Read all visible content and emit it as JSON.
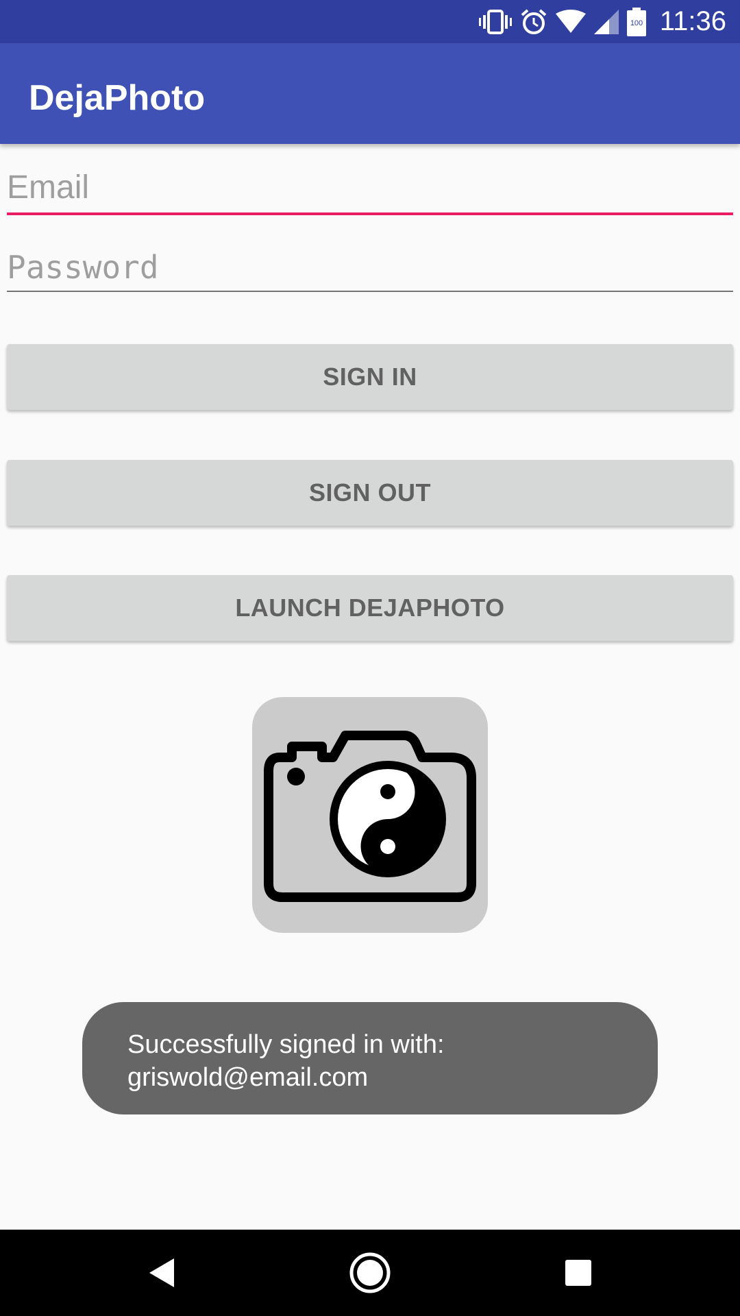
{
  "status_bar": {
    "time": "11:36",
    "battery_level": "100",
    "icons": [
      "vibrate-icon",
      "alarm-icon",
      "wifi-icon",
      "cell-signal-icon",
      "battery-icon"
    ]
  },
  "app_bar": {
    "title": "DejaPhoto"
  },
  "login": {
    "email_placeholder": "Email",
    "email_value": "",
    "password_placeholder": "Password",
    "password_value": ""
  },
  "buttons": {
    "sign_in": "SIGN IN",
    "sign_out": "SIGN OUT",
    "launch": "LAUNCH DEJAPHOTO"
  },
  "logo": {
    "icon": "camera-yin-yang-icon"
  },
  "toast": {
    "message": "Successfully signed in with:\ngriswold@email.com"
  },
  "nav_bar": {
    "icons": [
      "back-icon",
      "home-icon",
      "recents-icon"
    ]
  },
  "colors": {
    "status_bar": "#303f9f",
    "app_bar": "#3f51b5",
    "accent": "#e91e63",
    "button": "#d6d7d7",
    "toast": "#666666"
  }
}
